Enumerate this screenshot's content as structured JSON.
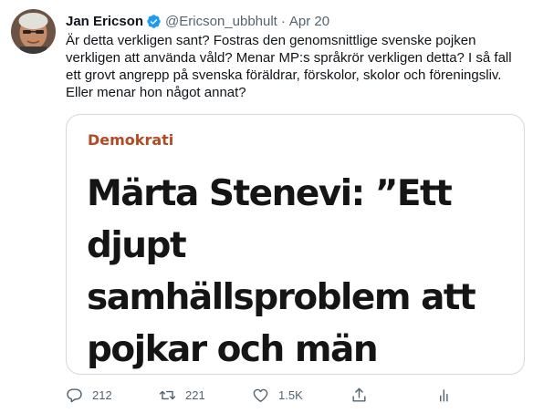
{
  "tweet": {
    "author_name": "Jan Ericson",
    "handle": "@Ericson_ubbhult",
    "separator": "·",
    "date": "Apr 20",
    "text": "Är detta verkligen sant? Fostras den genomsnittlige svenske pojken verkligen att använda våld? Menar MP:s språkrör verkligen detta? I så fall ett grovt angrepp på svenska föräldrar, förskolor, skolor och föreningsliv. Eller menar hon något annat?"
  },
  "card": {
    "category": "Demokrati",
    "headline": "Märta Stenevi: ”Ett djupt samhällsproblem att pojkar och män fostras att slå”"
  },
  "actions": {
    "reply_count": "212",
    "retweet_count": "221",
    "like_count": "1.5K"
  },
  "icons": {
    "verified": "verified-badge-icon",
    "reply": "reply-icon",
    "retweet": "retweet-icon",
    "like": "like-icon",
    "share": "share-icon",
    "analytics": "analytics-icon"
  },
  "colors": {
    "verified": "#1d9bf0",
    "category": "#b24b24",
    "secondary_text": "#536471",
    "border": "#cfd9de"
  }
}
